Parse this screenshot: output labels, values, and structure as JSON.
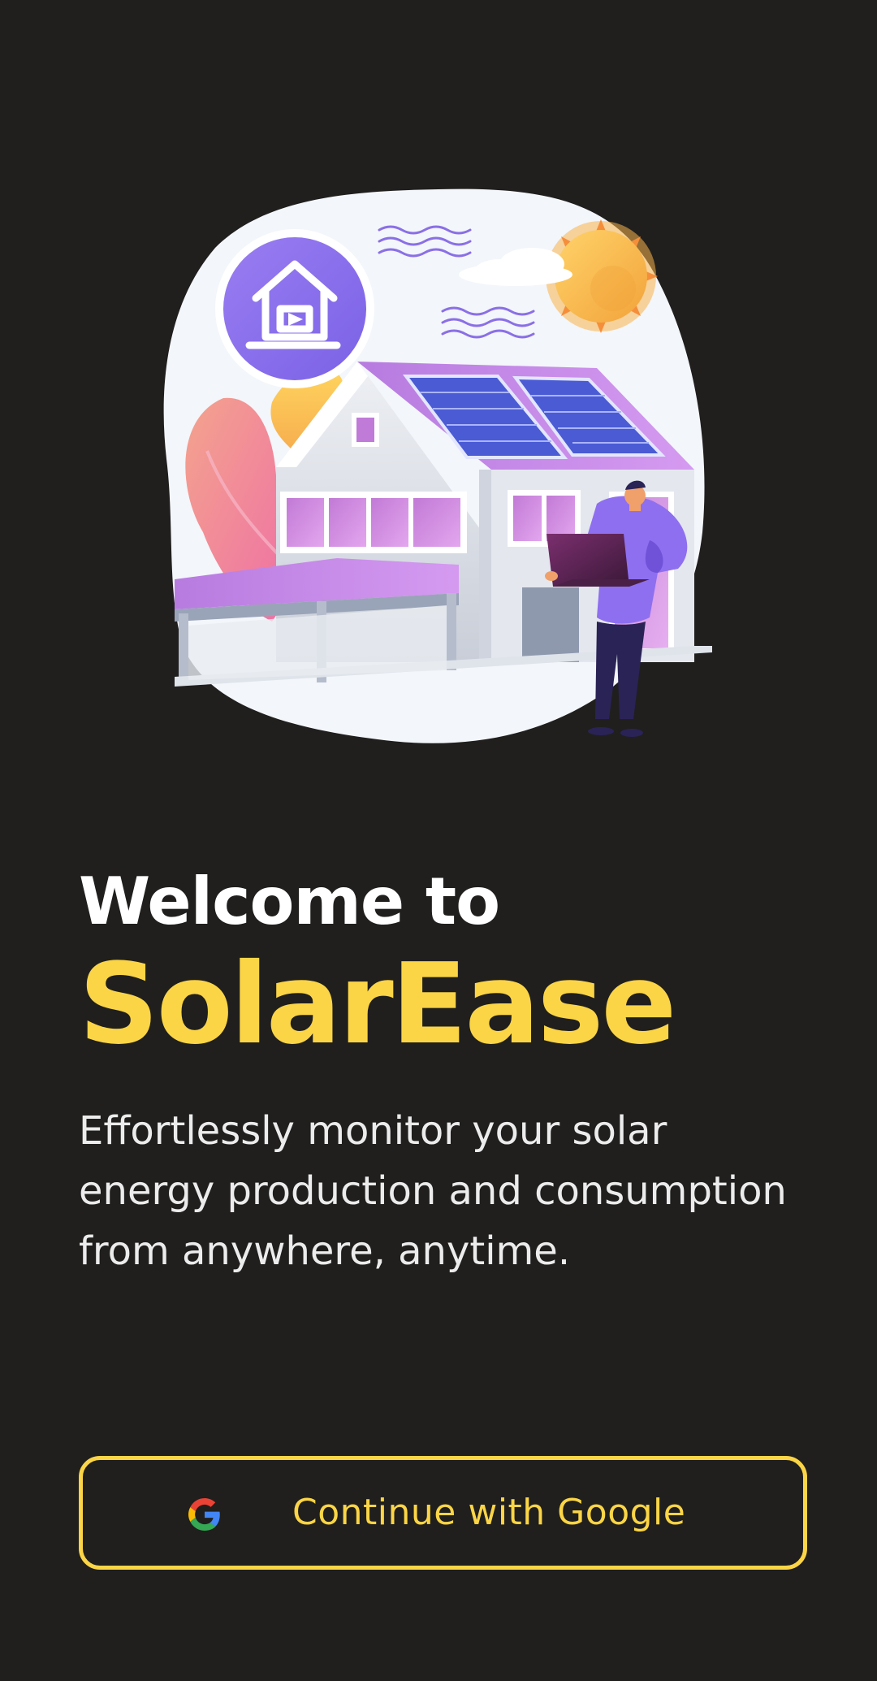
{
  "welcome": {
    "heading": "Welcome to",
    "app_name": "SolarEase",
    "tagline": "Effortlessly monitor your solar energy production and consumption from anywhere, anytime."
  },
  "auth": {
    "google_button_label": "Continue with Google",
    "google_icon": "google-g-icon"
  },
  "illustration": {
    "subject": "house-with-solar-panels-and-person-with-laptop",
    "icons": [
      "smart-home-icon",
      "sun-icon",
      "cloud-icon"
    ]
  },
  "colors": {
    "background": "#201f1e",
    "accent": "#fbd546",
    "text_primary": "#ffffff",
    "text_secondary": "#ececec",
    "illustration_purple": "#8e6ff0"
  }
}
